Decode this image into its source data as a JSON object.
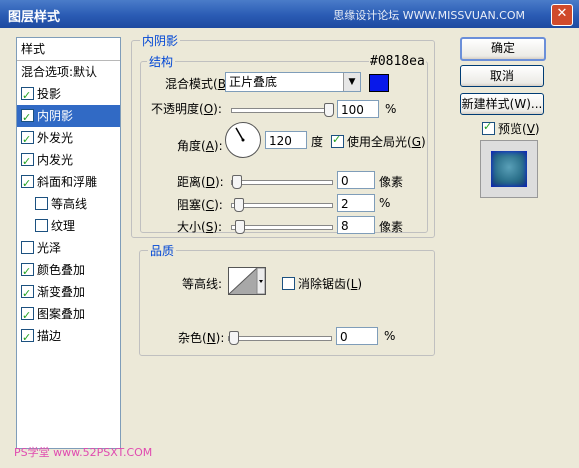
{
  "window": {
    "title": "图层样式",
    "watermark": "思缘设计论坛 WWW.MISSVUAN.COM",
    "bottom_watermark": "PS学堂 www.52PSXT.COM"
  },
  "left_panel": {
    "header": "样式",
    "items": [
      {
        "label": "混合选项:默认",
        "checkbox": false,
        "checked": false,
        "selected": false,
        "sub": false
      },
      {
        "label": "投影",
        "checkbox": true,
        "checked": true,
        "selected": false,
        "sub": false
      },
      {
        "label": "内阴影",
        "checkbox": true,
        "checked": true,
        "selected": true,
        "sub": false
      },
      {
        "label": "外发光",
        "checkbox": true,
        "checked": true,
        "selected": false,
        "sub": false
      },
      {
        "label": "内发光",
        "checkbox": true,
        "checked": true,
        "selected": false,
        "sub": false
      },
      {
        "label": "斜面和浮雕",
        "checkbox": true,
        "checked": true,
        "selected": false,
        "sub": false
      },
      {
        "label": "等高线",
        "checkbox": true,
        "checked": false,
        "selected": false,
        "sub": true
      },
      {
        "label": "纹理",
        "checkbox": true,
        "checked": false,
        "selected": false,
        "sub": true
      },
      {
        "label": "光泽",
        "checkbox": true,
        "checked": false,
        "selected": false,
        "sub": false
      },
      {
        "label": "颜色叠加",
        "checkbox": true,
        "checked": true,
        "selected": false,
        "sub": false
      },
      {
        "label": "渐变叠加",
        "checkbox": true,
        "checked": true,
        "selected": false,
        "sub": false
      },
      {
        "label": "图案叠加",
        "checkbox": true,
        "checked": true,
        "selected": false,
        "sub": false
      },
      {
        "label": "描边",
        "checkbox": true,
        "checked": true,
        "selected": false,
        "sub": false
      }
    ]
  },
  "inner_shadow": {
    "group_title": "内阴影",
    "structure_title": "结构",
    "color_hex_label": "#0818ea",
    "color": "#0818ea",
    "blend_mode_label": "混合模式(",
    "blend_mode_key": "B",
    "blend_mode_close": "):",
    "blend_mode_value": "正片叠底",
    "opacity_label": "不透明度(",
    "opacity_key": "O",
    "opacity_close": "):",
    "opacity_value": "100",
    "opacity_unit": "%",
    "opacity_fraction": 1.0,
    "angle_label": "角度(",
    "angle_key": "A",
    "angle_close": "):",
    "angle_value": "120",
    "angle_unit": "度",
    "global_light_label": "使用全局光(",
    "global_light_key": "G",
    "global_light_close": ")",
    "global_light_checked": true,
    "distance_label": "距离(",
    "distance_key": "D",
    "distance_close": "):",
    "distance_value": "0",
    "distance_unit": "像素",
    "distance_fraction": 0.0,
    "choke_label": "阻塞(",
    "choke_key": "C",
    "choke_close": "):",
    "choke_value": "2",
    "choke_unit": "%",
    "choke_fraction": 0.02,
    "size_label": "大小(",
    "size_key": "S",
    "size_close": "):",
    "size_value": "8",
    "size_unit": "像素",
    "size_fraction": 0.03
  },
  "quality": {
    "title": "品质",
    "contour_label": "等高线:",
    "anti_alias_label": "消除锯齿(",
    "anti_alias_key": "L",
    "anti_alias_close": ")",
    "anti_alias_checked": false,
    "noise_label": "杂色(",
    "noise_key": "N",
    "noise_close": "):",
    "noise_value": "0",
    "noise_unit": "%",
    "noise_fraction": 0.0
  },
  "buttons": {
    "ok": "确定",
    "cancel": "取消",
    "new_style": "新建样式(W)...",
    "preview_label": "预览(",
    "preview_key": "V",
    "preview_close": ")",
    "preview_checked": true
  }
}
